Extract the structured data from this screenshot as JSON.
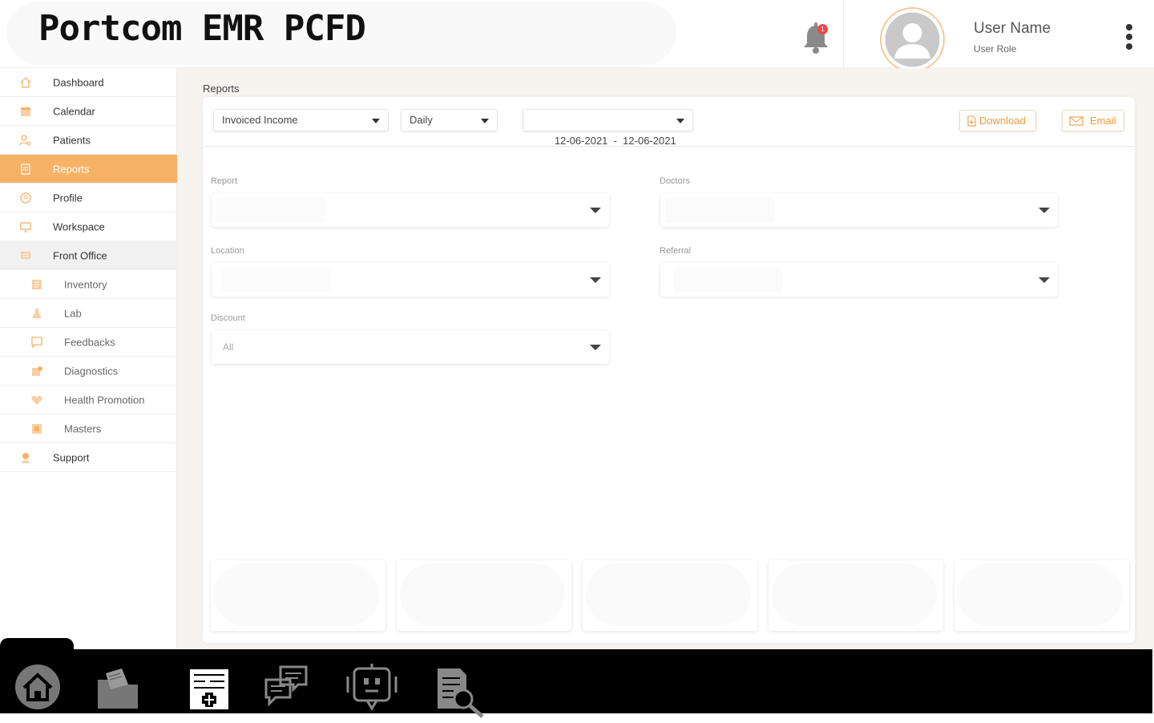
{
  "app": {
    "title": "Portcom EMR PCFD"
  },
  "header": {
    "notification_count": "1",
    "user_name": "User Name",
    "user_role": "User Role"
  },
  "sidebar": {
    "items": [
      {
        "label": "Dashboard",
        "icon": "home-icon"
      },
      {
        "label": "Calendar",
        "icon": "calendar-icon"
      },
      {
        "label": "Patients",
        "icon": "patients-icon"
      },
      {
        "label": "Reports",
        "icon": "reports-icon",
        "active": true
      },
      {
        "label": "Profile",
        "icon": "profile-icon"
      },
      {
        "label": "Workspace",
        "icon": "workspace-icon"
      },
      {
        "label": "Front Office",
        "icon": "front-office-icon"
      },
      {
        "label": "Inventory",
        "icon": "inventory-icon"
      },
      {
        "label": "Lab",
        "icon": "lab-icon"
      },
      {
        "label": "Feedbacks",
        "icon": "feedbacks-icon"
      },
      {
        "label": "Diagnostics",
        "icon": "diagnostics-icon"
      },
      {
        "label": "Health Promotion",
        "icon": "health-promotion-icon"
      },
      {
        "label": "Masters",
        "icon": "masters-icon"
      },
      {
        "label": "Support",
        "icon": "support-icon"
      }
    ]
  },
  "main": {
    "breadcrumb": "Reports",
    "toolbar": {
      "report_type": "Invoiced Income",
      "period": "Daily",
      "date_range": "12-06-2021  -  12-06-2021",
      "download_label": "Download",
      "email_label": "Email"
    },
    "filters": {
      "report_label": "Report",
      "doctors_label": "Doctors",
      "location_label": "Location",
      "referral_label": "Referral",
      "discount_label": "Discount",
      "discount_value": "All"
    }
  },
  "dock": {
    "items": [
      "home-icon",
      "folder-icon",
      "medical-record-icon",
      "chat-icon",
      "chatbot-icon",
      "document-search-icon"
    ]
  },
  "colors": {
    "accent": "#f8b266",
    "accent_text": "#f39a3c",
    "badge": "#f04848",
    "main_bg": "#f7f3ef"
  }
}
